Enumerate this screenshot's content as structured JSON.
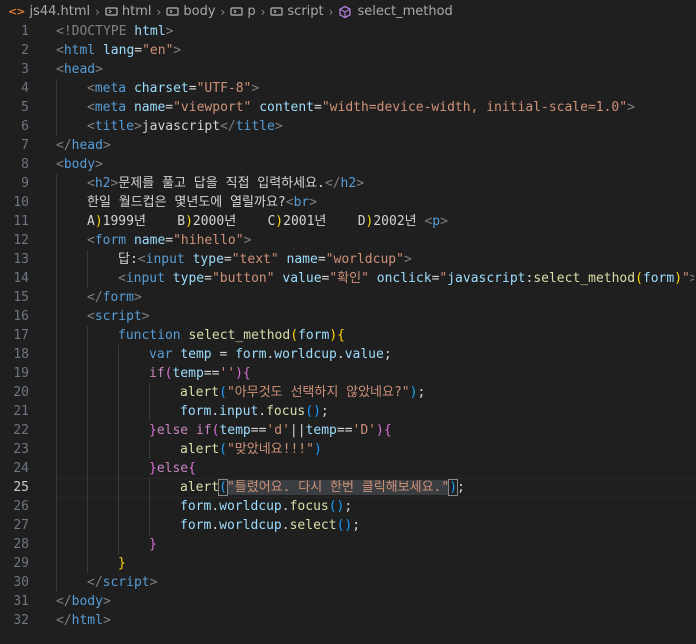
{
  "breadcrumb": [
    {
      "label": "js44.html",
      "icon": "html-file-icon"
    },
    {
      "label": "html",
      "icon": "element-tag-icon"
    },
    {
      "label": "body",
      "icon": "element-tag-icon"
    },
    {
      "label": "p",
      "icon": "element-tag-icon"
    },
    {
      "label": "script",
      "icon": "element-tag-icon"
    },
    {
      "label": "select_method",
      "icon": "method-cube-icon"
    }
  ],
  "current_line": 25,
  "colors": {
    "background": "#1f1f1f",
    "tag": "#569cd6",
    "attribute": "#9cdcfe",
    "string": "#ce9178",
    "control_keyword": "#c586c0",
    "function": "#dcdcaa",
    "line_number": "#6e7681"
  },
  "lines": [
    {
      "n": "1",
      "indent": 0,
      "tokens": [
        [
          "b",
          "<"
        ],
        [
          "b",
          "!DOCTYPE "
        ],
        [
          "a",
          "html"
        ],
        [
          "b",
          ">"
        ]
      ]
    },
    {
      "n": "2",
      "indent": 0,
      "tokens": [
        [
          "b",
          "<"
        ],
        [
          "t",
          "html"
        ],
        [
          "x",
          " "
        ],
        [
          "a",
          "lang"
        ],
        [
          "x",
          "="
        ],
        [
          "s",
          "\"en\""
        ],
        [
          "b",
          ">"
        ]
      ]
    },
    {
      "n": "3",
      "indent": 0,
      "tokens": [
        [
          "b",
          "<"
        ],
        [
          "t",
          "head"
        ],
        [
          "b",
          ">"
        ]
      ]
    },
    {
      "n": "4",
      "indent": 1,
      "tokens": [
        [
          "b",
          "<"
        ],
        [
          "t",
          "meta"
        ],
        [
          "x",
          " "
        ],
        [
          "a",
          "charset"
        ],
        [
          "x",
          "="
        ],
        [
          "s",
          "\"UTF-8\""
        ],
        [
          "b",
          ">"
        ]
      ]
    },
    {
      "n": "5",
      "indent": 1,
      "tokens": [
        [
          "b",
          "<"
        ],
        [
          "t",
          "meta"
        ],
        [
          "x",
          " "
        ],
        [
          "a",
          "name"
        ],
        [
          "x",
          "="
        ],
        [
          "s",
          "\"viewport\""
        ],
        [
          "x",
          " "
        ],
        [
          "a",
          "content"
        ],
        [
          "x",
          "="
        ],
        [
          "s",
          "\"width=device-width, initial-scale=1.0\""
        ],
        [
          "b",
          ">"
        ]
      ]
    },
    {
      "n": "6",
      "indent": 1,
      "tokens": [
        [
          "b",
          "<"
        ],
        [
          "t",
          "title"
        ],
        [
          "b",
          ">"
        ],
        [
          "x",
          "javascript"
        ],
        [
          "b",
          "</"
        ],
        [
          "t",
          "title"
        ],
        [
          "b",
          ">"
        ]
      ]
    },
    {
      "n": "7",
      "indent": 0,
      "tokens": [
        [
          "b",
          "</"
        ],
        [
          "t",
          "head"
        ],
        [
          "b",
          ">"
        ]
      ]
    },
    {
      "n": "8",
      "indent": 0,
      "tokens": [
        [
          "b",
          "<"
        ],
        [
          "t",
          "body"
        ],
        [
          "b",
          ">"
        ]
      ]
    },
    {
      "n": "9",
      "indent": 1,
      "tokens": [
        [
          "b",
          "<"
        ],
        [
          "t",
          "h2"
        ],
        [
          "b",
          ">"
        ],
        [
          "x",
          "문제를 풀고 답을 직접 입력하세요."
        ],
        [
          "b",
          "</"
        ],
        [
          "t",
          "h2"
        ],
        [
          "b",
          ">"
        ]
      ]
    },
    {
      "n": "10",
      "indent": 1,
      "tokens": [
        [
          "x",
          "한일 월드컵은 몇년도에 열릴까요?"
        ],
        [
          "b",
          "<"
        ],
        [
          "t",
          "br"
        ],
        [
          "b",
          ">"
        ]
      ]
    },
    {
      "n": "11",
      "indent": 1,
      "tokens": [
        [
          "x",
          "A"
        ],
        [
          "p1",
          ")"
        ],
        [
          "x",
          "1999년    B"
        ],
        [
          "p1",
          ")"
        ],
        [
          "x",
          "2000년    C"
        ],
        [
          "p1",
          ")"
        ],
        [
          "x",
          "2001년    D"
        ],
        [
          "p1",
          ")"
        ],
        [
          "x",
          "2002년 "
        ],
        [
          "b",
          "<"
        ],
        [
          "t",
          "p"
        ],
        [
          "b",
          ">"
        ]
      ]
    },
    {
      "n": "12",
      "indent": 1,
      "tokens": [
        [
          "b",
          "<"
        ],
        [
          "t",
          "form"
        ],
        [
          "x",
          " "
        ],
        [
          "a",
          "name"
        ],
        [
          "x",
          "="
        ],
        [
          "s",
          "\"hihello\""
        ],
        [
          "b",
          ">"
        ]
      ]
    },
    {
      "n": "13",
      "indent": 2,
      "tokens": [
        [
          "x",
          "답:"
        ],
        [
          "b",
          "<"
        ],
        [
          "t",
          "input"
        ],
        [
          "x",
          " "
        ],
        [
          "a",
          "type"
        ],
        [
          "x",
          "="
        ],
        [
          "s",
          "\"text\""
        ],
        [
          "x",
          " "
        ],
        [
          "a",
          "name"
        ],
        [
          "x",
          "="
        ],
        [
          "s",
          "\"worldcup\""
        ],
        [
          "b",
          ">"
        ]
      ]
    },
    {
      "n": "14",
      "indent": 2,
      "tokens": [
        [
          "b",
          "<"
        ],
        [
          "t",
          "input"
        ],
        [
          "x",
          " "
        ],
        [
          "a",
          "type"
        ],
        [
          "x",
          "="
        ],
        [
          "s",
          "\"button\""
        ],
        [
          "x",
          " "
        ],
        [
          "a",
          "value"
        ],
        [
          "x",
          "="
        ],
        [
          "s",
          "\"확인\""
        ],
        [
          "x",
          " "
        ],
        [
          "a",
          "onclick"
        ],
        [
          "x",
          "="
        ],
        [
          "s",
          "\""
        ],
        [
          "v",
          "javascript"
        ],
        [
          "x",
          ":"
        ],
        [
          "f",
          "select_method"
        ],
        [
          "p1",
          "("
        ],
        [
          "v",
          "form"
        ],
        [
          "p1",
          ")"
        ],
        [
          "s",
          "\""
        ],
        [
          "b",
          ">"
        ]
      ]
    },
    {
      "n": "15",
      "indent": 1,
      "tokens": [
        [
          "b",
          "</"
        ],
        [
          "t",
          "form"
        ],
        [
          "b",
          ">"
        ]
      ]
    },
    {
      "n": "16",
      "indent": 1,
      "tokens": [
        [
          "b",
          "<"
        ],
        [
          "t",
          "script"
        ],
        [
          "b",
          ">"
        ]
      ]
    },
    {
      "n": "17",
      "indent": 2,
      "tokens": [
        [
          "k",
          "function"
        ],
        [
          "x",
          " "
        ],
        [
          "f",
          "select_method"
        ],
        [
          "p1",
          "("
        ],
        [
          "v",
          "form"
        ],
        [
          "p1",
          "){"
        ]
      ]
    },
    {
      "n": "18",
      "indent": 3,
      "tokens": [
        [
          "k",
          "var"
        ],
        [
          "x",
          " "
        ],
        [
          "v",
          "temp"
        ],
        [
          "x",
          " = "
        ],
        [
          "v",
          "form"
        ],
        [
          "x",
          "."
        ],
        [
          "v",
          "worldcup"
        ],
        [
          "x",
          "."
        ],
        [
          "v",
          "value"
        ],
        [
          "x",
          ";"
        ]
      ]
    },
    {
      "n": "19",
      "indent": 3,
      "tokens": [
        [
          "c",
          "if"
        ],
        [
          "p2",
          "("
        ],
        [
          "v",
          "temp"
        ],
        [
          "x",
          "=="
        ],
        [
          "s",
          "''"
        ],
        [
          "p2",
          "){"
        ]
      ]
    },
    {
      "n": "20",
      "indent": 4,
      "tokens": [
        [
          "f",
          "alert"
        ],
        [
          "p3",
          "("
        ],
        [
          "s",
          "\"아무것도 선택하지 않았네요?\""
        ],
        [
          "p3",
          ")"
        ],
        [
          "x",
          ";"
        ]
      ]
    },
    {
      "n": "21",
      "indent": 4,
      "tokens": [
        [
          "v",
          "form"
        ],
        [
          "x",
          "."
        ],
        [
          "v",
          "input"
        ],
        [
          "x",
          "."
        ],
        [
          "f",
          "focus"
        ],
        [
          "p3",
          "()"
        ],
        [
          "x",
          ";"
        ]
      ]
    },
    {
      "n": "22",
      "indent": 3,
      "tokens": [
        [
          "p2",
          "}"
        ],
        [
          "c",
          "else"
        ],
        [
          "x",
          " "
        ],
        [
          "c",
          "if"
        ],
        [
          "p2",
          "("
        ],
        [
          "v",
          "temp"
        ],
        [
          "x",
          "=="
        ],
        [
          "s",
          "'d'"
        ],
        [
          "x",
          "||"
        ],
        [
          "v",
          "temp"
        ],
        [
          "x",
          "=="
        ],
        [
          "s",
          "'D'"
        ],
        [
          "p2",
          "){"
        ]
      ]
    },
    {
      "n": "23",
      "indent": 4,
      "tokens": [
        [
          "f",
          "alert"
        ],
        [
          "p3",
          "("
        ],
        [
          "s",
          "\"맞았네요!!!\""
        ],
        [
          "p3",
          ")"
        ]
      ]
    },
    {
      "n": "24",
      "indent": 3,
      "tokens": [
        [
          "p2",
          "}"
        ],
        [
          "c",
          "else"
        ],
        [
          "p2",
          "{"
        ]
      ]
    },
    {
      "n": "25",
      "indent": 4,
      "tokens": [
        [
          "f",
          "alert"
        ],
        [
          "p3box",
          "("
        ],
        [
          "sel",
          "\"틀렸어요. 다시 한번 클릭해보세요.\""
        ],
        [
          "p3box",
          ")"
        ],
        [
          "x",
          ";"
        ]
      ]
    },
    {
      "n": "26",
      "indent": 4,
      "tokens": [
        [
          "v",
          "form"
        ],
        [
          "x",
          "."
        ],
        [
          "v",
          "worldcup"
        ],
        [
          "x",
          "."
        ],
        [
          "f",
          "focus"
        ],
        [
          "p3",
          "()"
        ],
        [
          "x",
          ";"
        ]
      ]
    },
    {
      "n": "27",
      "indent": 4,
      "tokens": [
        [
          "v",
          "form"
        ],
        [
          "x",
          "."
        ],
        [
          "v",
          "worldcup"
        ],
        [
          "x",
          "."
        ],
        [
          "f",
          "select"
        ],
        [
          "p3",
          "()"
        ],
        [
          "x",
          ";"
        ]
      ]
    },
    {
      "n": "28",
      "indent": 3,
      "tokens": [
        [
          "p2",
          "}"
        ]
      ]
    },
    {
      "n": "29",
      "indent": 2,
      "tokens": [
        [
          "p1",
          "}"
        ]
      ]
    },
    {
      "n": "30",
      "indent": 1,
      "tokens": [
        [
          "b",
          "</"
        ],
        [
          "t",
          "script"
        ],
        [
          "b",
          ">"
        ]
      ]
    },
    {
      "n": "31",
      "indent": 0,
      "tokens": [
        [
          "b",
          "</"
        ],
        [
          "t",
          "body"
        ],
        [
          "b",
          ">"
        ]
      ]
    },
    {
      "n": "32",
      "indent": 0,
      "tokens": [
        [
          "b",
          "</"
        ],
        [
          "t",
          "html"
        ],
        [
          "b",
          ">"
        ]
      ]
    }
  ]
}
